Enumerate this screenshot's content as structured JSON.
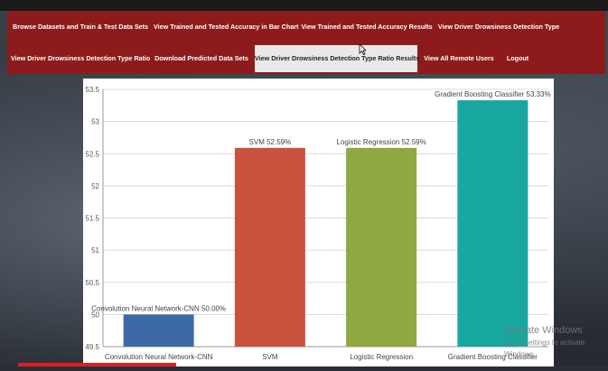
{
  "nav": {
    "row1": [
      "Browse Datasets and Train & Test Data Sets",
      "View Trained and Tested Accuracy in Bar Chart",
      "View Trained and Tested Accuracy Results",
      "View Driver Drowsiness Detection Type"
    ],
    "row2": [
      "View Driver Drowsiness Detection Type Ratio",
      "Download Predicted Data Sets",
      "View Driver Drowsiness Detection Type Ratio Results",
      "View All Remote Users",
      "Logout"
    ],
    "active_index_row2": 2
  },
  "chart_data": {
    "type": "bar",
    "categories": [
      "Convolution Neural Network-CNN",
      "SVM",
      "Logistic Regression",
      "Gradient Boosting Classifier"
    ],
    "values": [
      50.0,
      52.59,
      52.59,
      53.33
    ],
    "data_labels": [
      "Convolution Neural Network-CNN 50.00%",
      "SVM 52.59%",
      "Logistic Regression 52.59%",
      "Gradient Boosting Classifier 53.33%"
    ],
    "colors": [
      "#3d6aa6",
      "#c9533c",
      "#8fa83f",
      "#17a7a0"
    ],
    "ylim": [
      49.5,
      53.5
    ],
    "yticks": [
      49.5,
      50,
      50.5,
      51,
      51.5,
      52,
      52.5,
      53,
      53.5
    ],
    "grid": true
  },
  "watermark": {
    "line1": "Activate Windows",
    "line2": "Go to Settings to activate Windows."
  }
}
